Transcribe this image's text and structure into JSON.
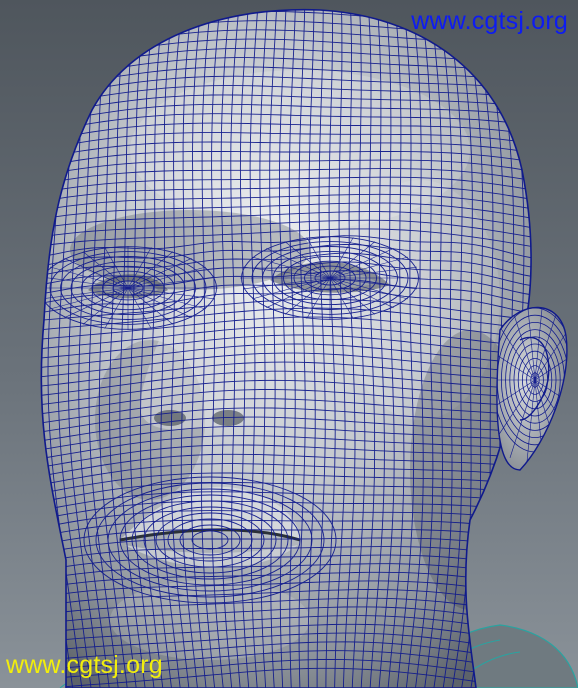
{
  "watermarks": {
    "top": {
      "text": "www.cgtsj.org",
      "color": "#0d1cf2"
    },
    "bottom": {
      "text": "www.cgtsj.org",
      "color": "#f2ee0c"
    }
  },
  "colors": {
    "background": "#6b737b",
    "surface": "#b9bdc2",
    "wireframe": "#101a8c",
    "shoulder_wire": "#2aa3a0"
  }
}
